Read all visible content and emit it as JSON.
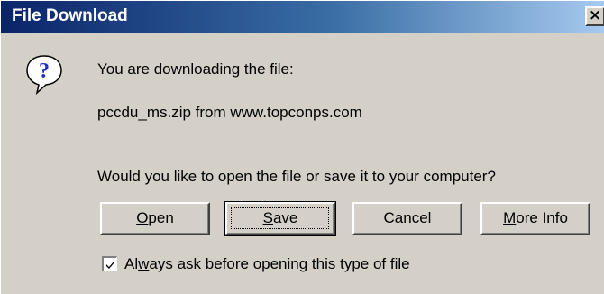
{
  "window": {
    "title": "File Download",
    "close_glyph": "×"
  },
  "message": {
    "line1": "You are downloading the file:",
    "file_line": "pccdu_ms.zip from www.topconps.com",
    "question": "Would you like to open the file or save it to your computer?"
  },
  "icons": {
    "dialog_icon": "question-icon",
    "check_glyph": "checkmark"
  },
  "buttons": {
    "open": {
      "mnemonic": "O",
      "rest": "pen"
    },
    "save": {
      "mnemonic": "S",
      "rest": "ave"
    },
    "cancel": "Cancel",
    "more_info": {
      "mnemonic": "M",
      "rest": "ore Info"
    }
  },
  "checkbox": {
    "checked": true,
    "label_before": "Al",
    "label_mnemonic": "w",
    "label_after": "ays ask before opening this type of file"
  },
  "colors": {
    "face": "#d4d0c8",
    "title_start": "#0a246a",
    "title_end": "#a6caf0"
  }
}
